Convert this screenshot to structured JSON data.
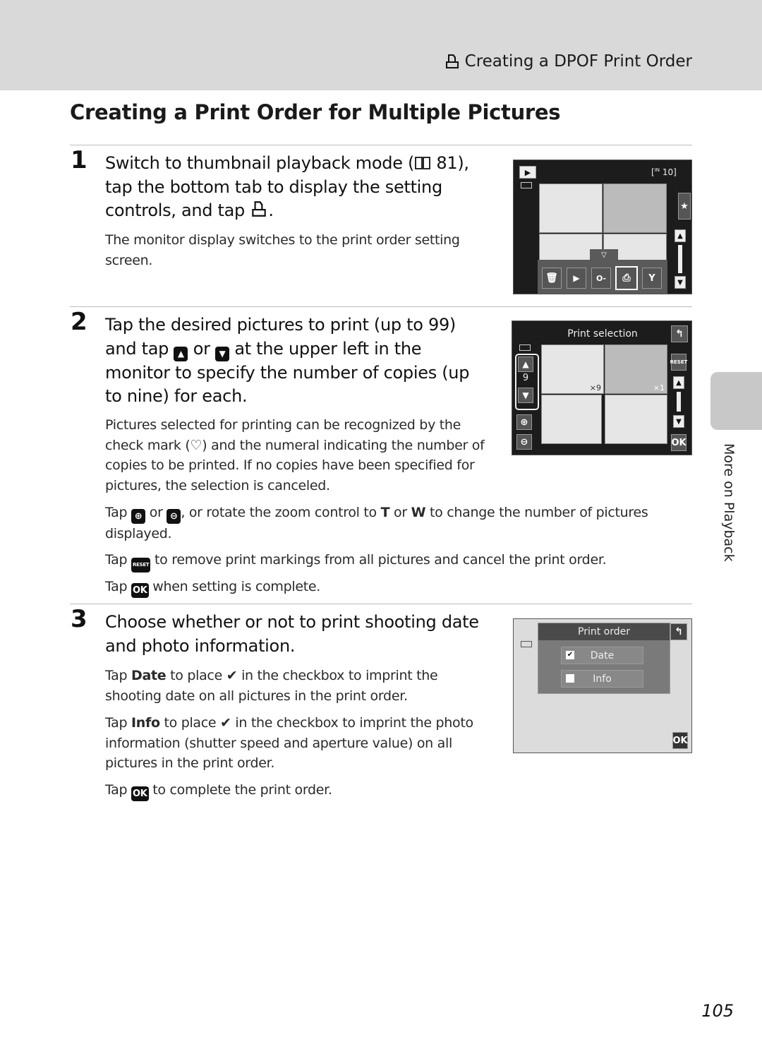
{
  "header": {
    "running_head": "Creating a DPOF Print Order",
    "running_head_icon": "print-order-icon"
  },
  "page_title": "Creating a Print Order for Multiple Pictures",
  "steps": [
    {
      "number": "1",
      "heading_parts": [
        "Switch to thumbnail playback mode (",
        " 81),",
        "tap the bottom tab to display the setting",
        "controls, and tap ",
        "."
      ],
      "body": "The monitor display switches to the print order setting screen.",
      "screen": {
        "counter": "10",
        "memory_label": "IN",
        "bottom_menu_icons": [
          "delete-icon",
          "slideshow-icon",
          "protect-icon",
          "print-order-icon",
          "setup-icon"
        ],
        "selected_menu_icon": "print-order-icon"
      }
    },
    {
      "number": "2",
      "heading_lines": [
        "Tap the desired pictures to print (up to 99)",
        "and tap ",
        " or ",
        " at the upper left in the",
        "monitor to specify the number of copies (up",
        "to nine) for each."
      ],
      "body_1_parts": [
        "Pictures selected for printing can be recognized by the check mark (",
        ") and the numeral indicating the number of copies to be printed. If no copies have been specified for pictures, the selection is canceled."
      ],
      "body_2_parts": [
        "Tap ",
        " or ",
        ", or rotate the zoom control to ",
        "T",
        " or ",
        "W",
        " to change the number of pictures displayed."
      ],
      "body_3_parts": [
        "Tap ",
        " to remove print markings from all pictures and cancel the print order."
      ],
      "body_4_parts": [
        "Tap ",
        " when setting is complete."
      ],
      "screen": {
        "title": "Print selection",
        "copies_value": "9",
        "thumb_counts": [
          "×9",
          "×1"
        ],
        "reset_label": "RESET",
        "ok_label": "OK"
      }
    },
    {
      "number": "3",
      "heading_lines": [
        "Choose whether or not to print shooting date",
        "and photo information."
      ],
      "body_1_parts": [
        "Tap ",
        "Date",
        " to place ",
        " in the checkbox to imprint the shooting date on all pictures in the print order."
      ],
      "body_2_parts": [
        "Tap ",
        "Info",
        " to place ",
        " in the checkbox to imprint the photo information (shutter speed and aperture value) on all pictures in the print order."
      ],
      "body_3_parts": [
        "Tap ",
        " to complete the print order."
      ],
      "screen": {
        "title": "Print order",
        "options": [
          {
            "label": "Date",
            "checked": true
          },
          {
            "label": "Info",
            "checked": false
          }
        ],
        "ok_label": "OK"
      }
    }
  ],
  "side_tab": {
    "label": "More on Playback"
  },
  "page_number": "105",
  "key_labels": {
    "ok": "OK",
    "reset": "RESET"
  }
}
